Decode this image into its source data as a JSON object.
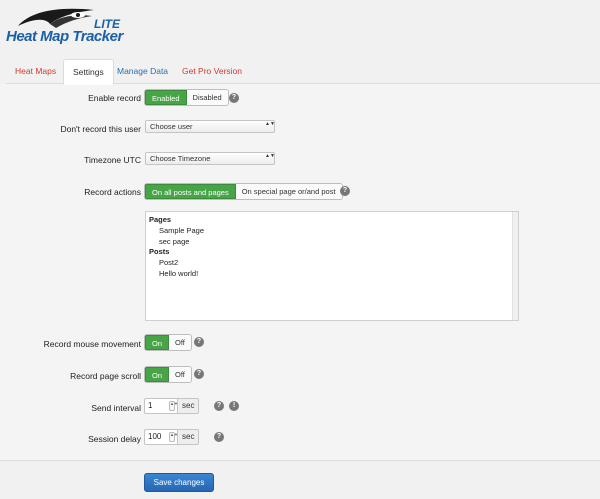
{
  "logo": {
    "lite": "LITE",
    "name": "Heat Map Tracker"
  },
  "tabs": [
    {
      "label": "Heat Maps"
    },
    {
      "label": "Settings"
    },
    {
      "label": "Manage Data"
    },
    {
      "label": "Get Pro Version"
    }
  ],
  "help_glyph": "?",
  "warn_glyph": "!",
  "select_arrows": "▲▼",
  "spin_arrows": "▲▼",
  "form": {
    "enable_record": {
      "label": "Enable record",
      "on": "Enabled",
      "off": "Disabled",
      "value": "Enabled"
    },
    "dont_record_user": {
      "label": "Don't record this user",
      "value": "Choose user"
    },
    "timezone": {
      "label": "Timezone UTC",
      "value": "Choose Timezone"
    },
    "record_actions": {
      "label": "Record actions",
      "on": "On all posts and pages",
      "off": "On special page or/and post",
      "value": "On all posts and pages",
      "groups": [
        {
          "label": "Pages",
          "items": [
            "Sample Page",
            "sec page"
          ]
        },
        {
          "label": "Posts",
          "items": [
            "Post2",
            "Hello world!"
          ]
        }
      ]
    },
    "record_mouse": {
      "label": "Record mouse movement",
      "on": "On",
      "off": "Off",
      "value": "On"
    },
    "record_scroll": {
      "label": "Record page scroll",
      "on": "On",
      "off": "Off",
      "value": "On"
    },
    "send_interval": {
      "label": "Send interval",
      "value": "1",
      "unit": "sec"
    },
    "session_delay": {
      "label": "Session delay",
      "value": "100",
      "unit": "sec"
    }
  },
  "save_button": "Save changes"
}
